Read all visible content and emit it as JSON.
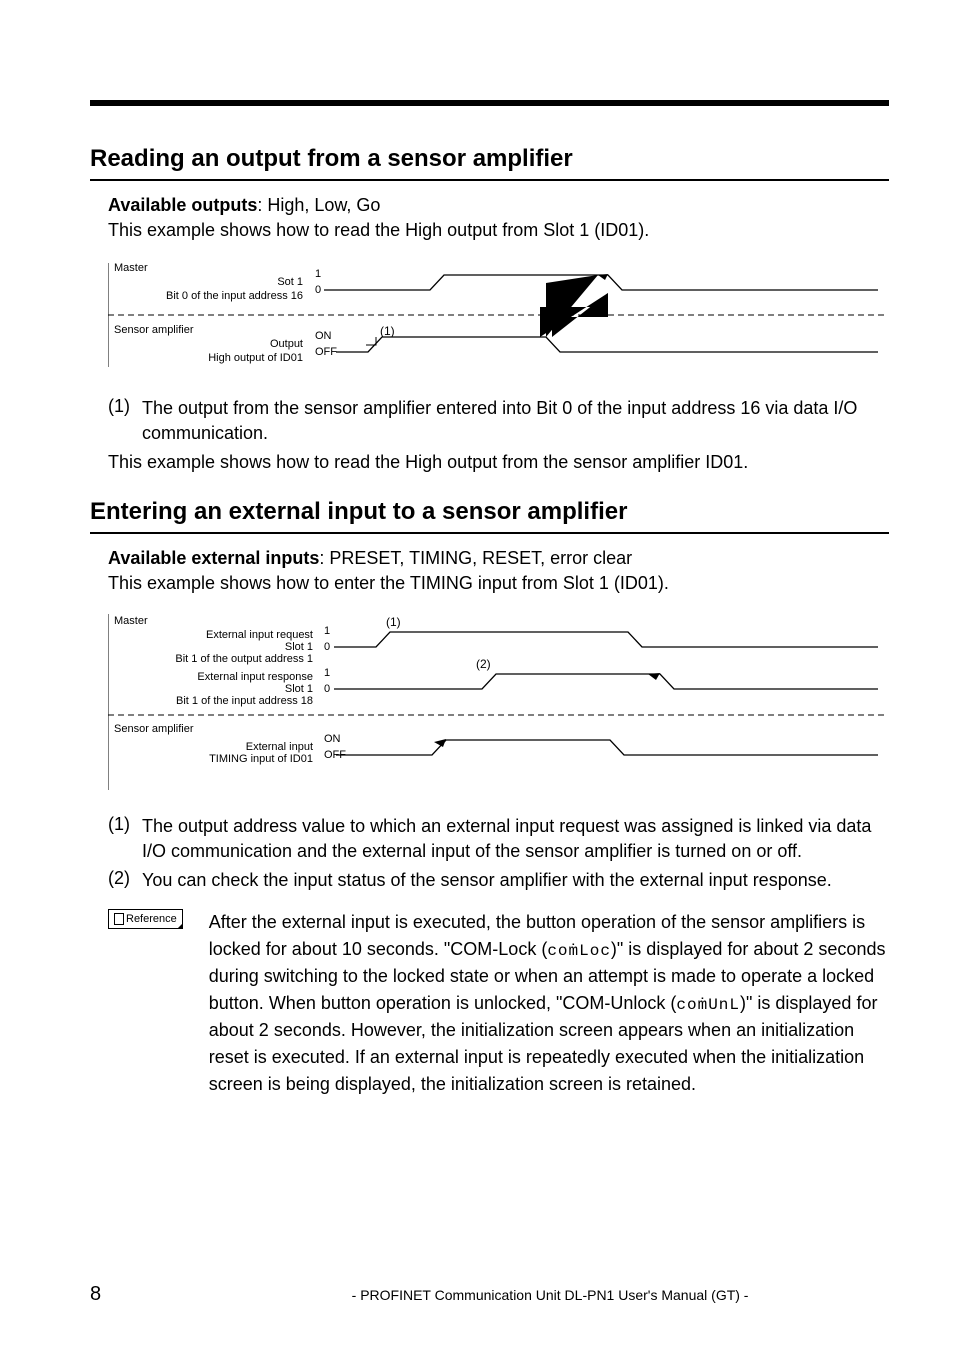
{
  "section1": {
    "title": "Reading an output from a sensor amplifier",
    "available_label": "Available outputs",
    "available_values": ": High, Low, Go",
    "example": "This example shows how to read the High output from Slot 1 (ID01).",
    "diagram": {
      "master": "Master",
      "slot": "Sot 1",
      "bit": "Bit 0 of the input address 16",
      "one": "1",
      "zero": "0",
      "sensor": "Sensor amplifier",
      "output": "Output",
      "high": "High output of ID01",
      "on": "ON",
      "off": "OFF",
      "ann1": "(1)"
    },
    "note1_num": "(1)",
    "note1": "The output from the sensor amplifier entered into Bit 0 of the input address 16 via data I/O communication.",
    "note2": "This example shows how to read the High output from the sensor amplifier ID01."
  },
  "section2": {
    "title": "Entering an external input to a sensor amplifier",
    "available_label": "Available external inputs",
    "available_values": ": PRESET, TIMING, RESET, error clear",
    "example": "This example shows how to enter the TIMING input from Slot 1 (ID01).",
    "diagram": {
      "master": "Master",
      "req": "External input request",
      "slot1a": "Slot 1",
      "bit_out": "Bit 1 of the output address 1",
      "resp": "External input response",
      "slot1b": "Slot 1",
      "bit_in": "Bit 1 of the input address 18",
      "sensor": "Sensor amplifier",
      "ext": "External input",
      "timing": "TIMING input of ID01",
      "one": "1",
      "zero": "0",
      "on": "ON",
      "off": "OFF",
      "ann1": "(1)",
      "ann2": "(2)"
    },
    "note1_num": "(1)",
    "note1": "The output address value to which an external input request was assigned is linked via data I/O communication and the external input of the sensor amplifier is turned on or off.",
    "note2_num": "(2)",
    "note2": "You can check the input status of the sensor amplifier with the external input response."
  },
  "reference": {
    "label": "Reference",
    "text_before_comloc": "After the external input is executed, the button operation of the sensor amplifiers is locked for about 10 seconds. \"COM-Lock (",
    "comloc": "coṁLoc",
    "text_between": ")\" is displayed for about 2 seconds during switching to the locked state or when an attempt is made to operate a locked button. When button operation is unlocked, \"COM-Unlock (",
    "comunl": "coṁUnL",
    "text_after": ")\" is displayed for about 2 seconds. However, the initialization screen appears when an initialization reset is executed. If an external input is repeatedly executed when the initialization screen is being displayed, the initialization screen is retained."
  },
  "footer": {
    "page": "8",
    "text": "- PROFINET Communication Unit DL-PN1 User's Manual (GT) -"
  }
}
